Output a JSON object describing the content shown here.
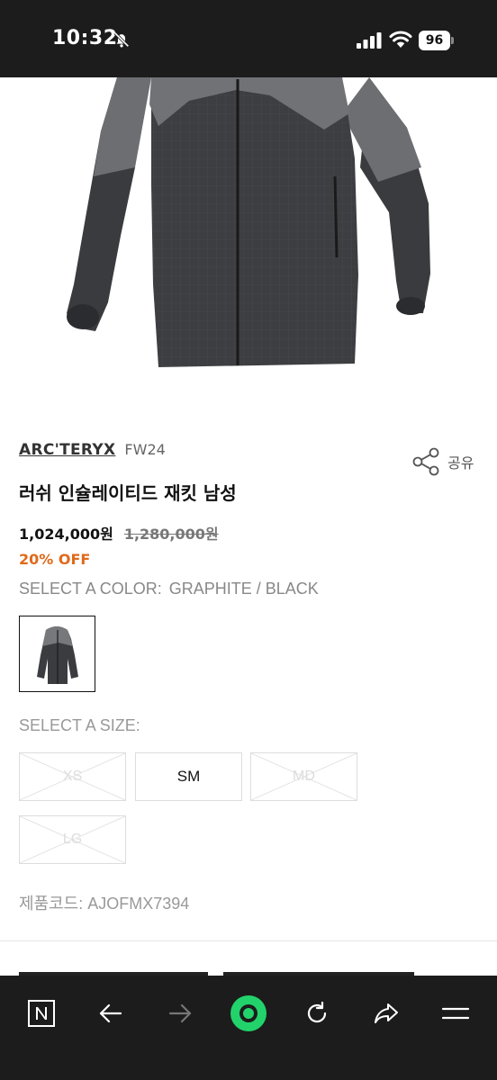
{
  "status_bar": {
    "time": "10:32",
    "battery": "96",
    "icons": [
      "bell-off-icon",
      "signal-icon",
      "wifi-icon",
      "battery-icon"
    ]
  },
  "product": {
    "brand": "ARC'TERYX",
    "season": "FW24",
    "share_label": "공유",
    "title": "러쉬 인슐레이티드 재킷 남성",
    "price": "1,024,000원",
    "original_price": "1,280,000원",
    "discount": "20% OFF",
    "color_label": "SELECT A COLOR:",
    "color_value": "GRAPHITE / BLACK",
    "size_label": "SELECT A SIZE:",
    "sizes": [
      {
        "label": "XS",
        "available": false
      },
      {
        "label": "SM",
        "available": true
      },
      {
        "label": "MD",
        "available": false
      },
      {
        "label": "LG",
        "available": false
      }
    ],
    "code_label": "제품코드:",
    "code_value": "AJOFMX7394"
  },
  "colors": {
    "accent_discount": "#e06a1b",
    "browser_green": "#22d36b",
    "bar_bg": "#1c1c1c"
  },
  "browser_toolbar": {
    "icons": [
      "naver-n-icon",
      "back-arrow-icon",
      "forward-arrow-icon",
      "green-dot-home-icon",
      "reload-icon",
      "share-arrow-icon",
      "menu-icon"
    ]
  }
}
